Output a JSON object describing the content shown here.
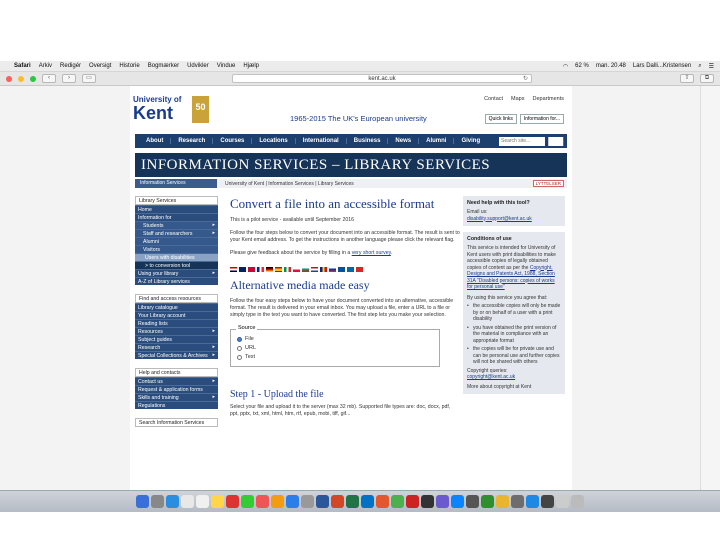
{
  "menubar": {
    "items": [
      "Safari",
      "Arkiv",
      "Redigér",
      "Oversigt",
      "Historie",
      "Bogmærker",
      "Udvikler",
      "Vindue",
      "Hjælp"
    ],
    "clock": "man. 20.48",
    "user": "Lars Dalli...Kristensen",
    "battery": "62 %"
  },
  "browser": {
    "url": "kent.ac.uk"
  },
  "header": {
    "logo_top": "University of",
    "logo_main": "Kent",
    "badge": "50",
    "tagline": "1965-2015 The UK's European university",
    "toplinks": [
      "Contact",
      "Maps",
      "Departments"
    ],
    "quick_links": [
      "Quick links",
      "Information for..."
    ]
  },
  "mainnav": {
    "items": [
      "About",
      "Research",
      "Courses",
      "Locations",
      "International",
      "Business",
      "News",
      "Alumni",
      "Giving"
    ],
    "search_placeholder": "Search site..."
  },
  "banner": {
    "title": "INFORMATION SERVICES – LIBRARY SERVICES"
  },
  "breadcrumb": {
    "dropdown": "Information Services",
    "path": "University of Kent  |  Information Services  |  Library Services",
    "readspeaker": "LYTTELSER"
  },
  "leftnav": {
    "group1_title": "Library Services",
    "group1": [
      {
        "label": "Home",
        "style": "plain"
      },
      {
        "label": "Information for",
        "style": "plain"
      },
      {
        "label": "Students",
        "style": "sub",
        "arrow": true
      },
      {
        "label": "Staff and researchers",
        "style": "sub",
        "arrow": true
      },
      {
        "label": "Alumni",
        "style": "sub"
      },
      {
        "label": "Visitors",
        "style": "sub"
      },
      {
        "label": "Users with disabilities",
        "style": "sub2"
      },
      {
        "label": "> to conversion tool",
        "style": "cur"
      },
      {
        "label": "Using your library",
        "style": "plain",
        "arrow": true
      },
      {
        "label": "A-Z of Library services",
        "style": "plain"
      }
    ],
    "group2_title": "Find and access resources",
    "group2": [
      {
        "label": "Library catalogue"
      },
      {
        "label": "Your Library account"
      },
      {
        "label": "Reading lists"
      },
      {
        "label": "Resources",
        "arrow": true
      },
      {
        "label": "Subject guides"
      },
      {
        "label": "Research",
        "arrow": true
      },
      {
        "label": "Special Collections & Archives",
        "arrow": true
      }
    ],
    "group3_title": "Help and contacts",
    "group3": [
      {
        "label": "Contact us",
        "arrow": true
      },
      {
        "label": "Request & application forms"
      },
      {
        "label": "Skills and training",
        "arrow": true
      },
      {
        "label": "Regulations"
      }
    ],
    "search_label": "Search Information Services"
  },
  "content": {
    "title": "Convert a file into an accessible format",
    "pilot": "This is a pilot service - available until September 2016",
    "intro": "Follow the four steps below to convert your document into an accessible format. The result is sent to your Kent email address. To get the instructions in another language please click the relevant flag.",
    "feedback_pre": "Please give feedback about the service by filling in a ",
    "feedback_link": "very short survey",
    "section_title": "Alternative media made easy",
    "section_body": "Follow the four easy steps below to have your document converted into an alternative, accessible format. The result is delivered in your email inbox. You may upload a file, enter a URL to a file or simply type in the text you want to have converted. The first step lets you make your selection.",
    "source_legend": "Source",
    "source_options": [
      {
        "label": "File",
        "checked": true
      },
      {
        "label": "URL",
        "checked": false
      },
      {
        "label": "Text",
        "checked": false
      }
    ],
    "step_title": "Step 1 - Upload the file",
    "step_body": "Select your file and upload it to the server (max 32 mb). Supported file types are: doc, docx, pdf, ppt, pptx, txt, xml, html, htm, rtf, epub, mobi, tiff, gif..."
  },
  "rightcol": {
    "help_title": "Need help with this tool?",
    "help_email_label": "Email us:",
    "help_email": "disability.support@kent.ac.uk",
    "cond_title": "Conditions of use",
    "cond_body": "This service is intended for University of Kent users with print disabilities to make accessible copies of legally obtained copies of content as per the ",
    "cond_link": "Copyright, Designs and Patents Act, 1988, Section 31A \"Disabled persons: copies of works for personal use\"",
    "agree": "By using this service you agree that:",
    "bullets": [
      "the accessible copies will only be made by or on behalf of a user with a print disability",
      "you have obtained the print version of the material in compliance with an appropriate format",
      "the copies will be for private use and can be personal use and further copies will not be shared with others"
    ],
    "copyright_label": "Copyright queries:",
    "copyright_email": "copyright@kent.ac.uk",
    "more": "More about copyright at Kent"
  },
  "colors": {
    "brand": "#1a3c8c",
    "nav": "#1d3f6e",
    "gold": "#c9a23a"
  }
}
